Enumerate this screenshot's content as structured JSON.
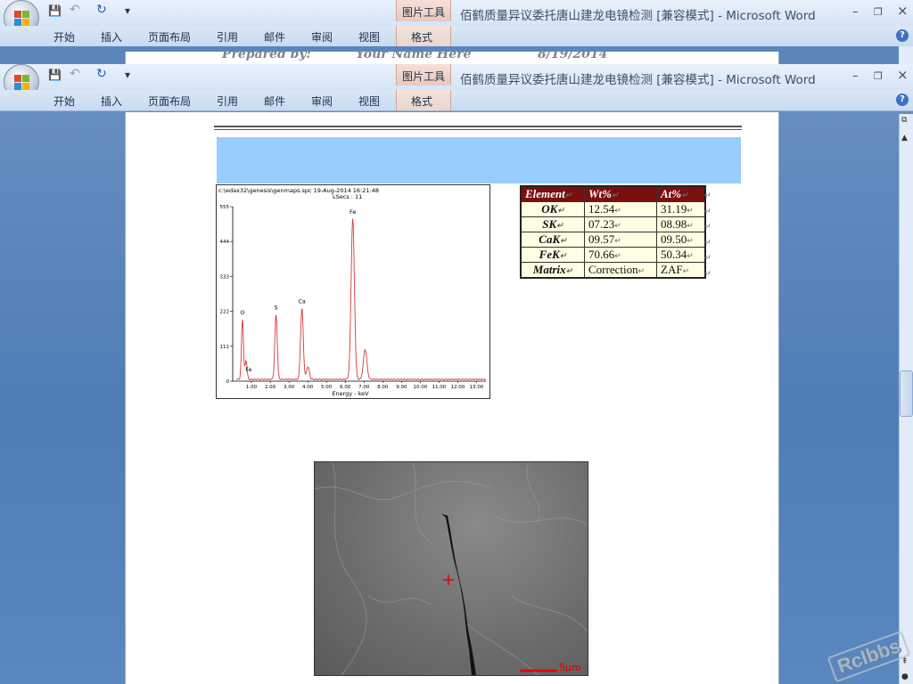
{
  "window": {
    "title": "佰鹤质量异议委托唐山建龙电镜检测 [兼容模式] - Microsoft Word",
    "context_tab": "图片工具",
    "controls": {
      "minimize": "–",
      "restore": "❐",
      "close": "×",
      "help": "?"
    }
  },
  "quick_access": {
    "save": "💾",
    "undo": "↶",
    "redo": "↻",
    "customize": "▾"
  },
  "ribbon": {
    "tabs": [
      "开始",
      "插入",
      "页面布局",
      "引用",
      "邮件",
      "审阅",
      "视图",
      "格式"
    ]
  },
  "ghost_header": {
    "prepared": "Prepared by:",
    "name": "Your Name Here",
    "date": "8/19/2014"
  },
  "spectrum": {
    "header_line1": "c:\\edax32\\genesis\\genmaps.spc  19-Aug-2014 16:21:48",
    "header_line2": "LSecs : 11",
    "x_label": "Energy - keV",
    "peak_labels": [
      "O",
      "Fe",
      "S",
      "Ca",
      "Fe"
    ]
  },
  "chart_data": {
    "type": "line",
    "title": "",
    "xlabel": "Energy - keV",
    "ylabel": "",
    "xlim": [
      0,
      13.5
    ],
    "ylim": [
      0,
      555
    ],
    "x_ticks": [
      "1.00",
      "2.00",
      "3.00",
      "4.00",
      "5.00",
      "6.00",
      "7.00",
      "8.00",
      "9.00",
      "10.00",
      "11.00",
      "12.00",
      "13.00"
    ],
    "y_ticks": [
      "0",
      "111",
      "222",
      "333",
      "444",
      "555"
    ],
    "peaks": [
      {
        "label": "O",
        "energy": 0.52,
        "counts": 190
      },
      {
        "label": "Fe",
        "energy": 0.71,
        "counts": 60
      },
      {
        "label": "S",
        "energy": 2.31,
        "counts": 205
      },
      {
        "label": "Ca",
        "energy": 3.69,
        "counts": 225
      },
      {
        "label": "",
        "energy": 4.01,
        "counts": 40
      },
      {
        "label": "Fe",
        "energy": 6.4,
        "counts": 510
      },
      {
        "label": "",
        "energy": 7.06,
        "counts": 95
      }
    ],
    "line_color": "#d43a3a"
  },
  "table": {
    "headers": [
      "Element",
      "Wt%",
      "At%"
    ],
    "rows": [
      [
        "OK",
        "12.54",
        "31.19"
      ],
      [
        "SK",
        "07.23",
        "08.98"
      ],
      [
        "CaK",
        "09.57",
        "09.50"
      ],
      [
        "FeK",
        "70.66",
        "50.34"
      ],
      [
        "Matrix",
        "Correction",
        "ZAF"
      ]
    ]
  },
  "sem": {
    "scale_label": "5μm"
  },
  "watermark": "Rclbbs",
  "colors": {
    "table_header": "#7a0f10",
    "table_cell": "#fffde2",
    "band": "#99ccff"
  }
}
